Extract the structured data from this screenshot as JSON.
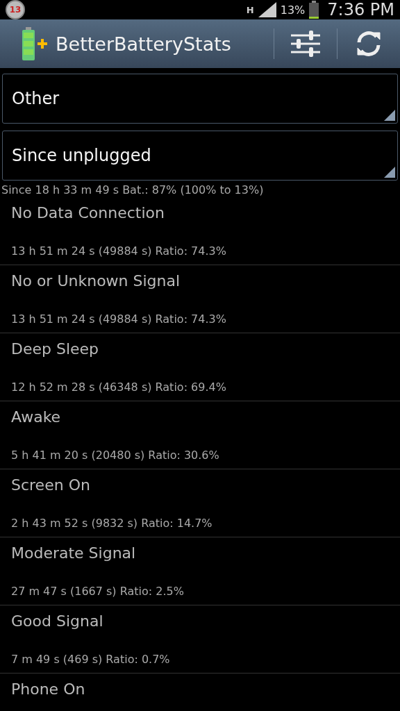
{
  "status_bar": {
    "notification_count": "13",
    "network_type": "H",
    "battery_percent": "13%",
    "time": "7:36 PM"
  },
  "action_bar": {
    "title": "BetterBatteryStats"
  },
  "dropdowns": [
    {
      "value": "Other"
    },
    {
      "value": "Since unplugged"
    }
  ],
  "summary": "Since 18 h 33 m 49 s  Bat.: 87% (100% to 13%)",
  "rows": [
    {
      "title": "No Data Connection",
      "detail": "13 h 51 m 24 s  (49884 s) Ratio: 74.3%"
    },
    {
      "title": "No or Unknown Signal",
      "detail": "13 h 51 m 24 s  (49884 s) Ratio: 74.3%"
    },
    {
      "title": "Deep Sleep",
      "detail": "12 h 52 m 28 s  (46348 s) Ratio: 69.4%"
    },
    {
      "title": "Awake",
      "detail": "5 h 41 m 20 s  (20480 s) Ratio: 30.6%"
    },
    {
      "title": "Screen On",
      "detail": "2 h 43 m 52 s  (9832 s) Ratio: 14.7%"
    },
    {
      "title": "Moderate Signal",
      "detail": "27 m 47 s  (1667 s) Ratio: 2.5%"
    },
    {
      "title": "Good Signal",
      "detail": "7 m 49 s  (469 s) Ratio: 0.7%"
    },
    {
      "title": "Phone On"
    }
  ]
}
